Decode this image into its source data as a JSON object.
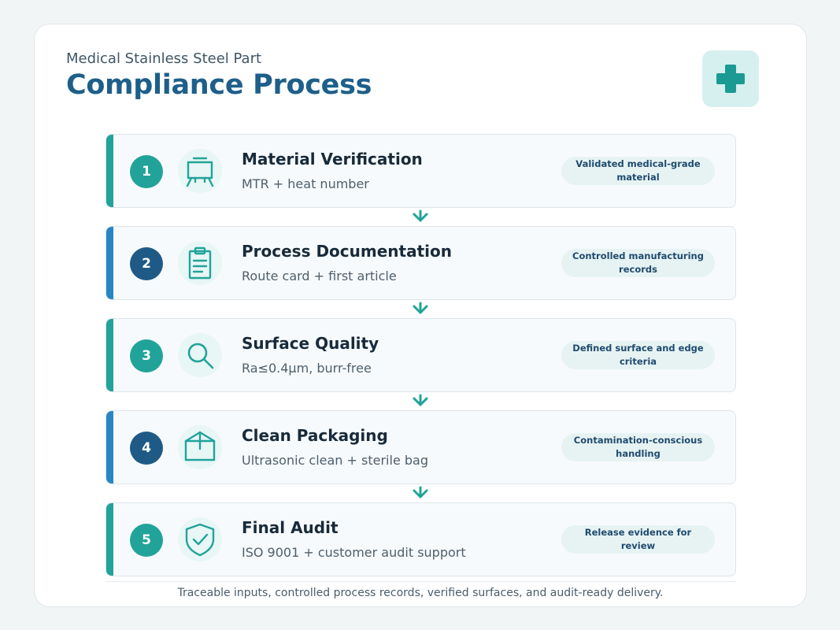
{
  "header": {
    "subtitle": "Medical Stainless Steel Part",
    "title": "Compliance Process",
    "badge_icon": "medical-cross-icon"
  },
  "colors": {
    "teal": "#22a39a",
    "blue": "#1f5a86",
    "accent_teal": "#22a39a",
    "accent_blue": "#2a86c2"
  },
  "steps": [
    {
      "number": "1",
      "title": "Material Verification",
      "description": "MTR + heat number",
      "outcome": "Validated medical-grade material",
      "icon": "easel-board-icon"
    },
    {
      "number": "2",
      "title": "Process Documentation",
      "description": "Route card + first article",
      "outcome": "Controlled manufacturing records",
      "icon": "clipboard-icon"
    },
    {
      "number": "3",
      "title": "Surface Quality",
      "description": "Ra≤0.4μm, burr-free",
      "outcome": "Defined surface and edge criteria",
      "icon": "magnifier-icon"
    },
    {
      "number": "4",
      "title": "Clean Packaging",
      "description": "Ultrasonic clean + sterile bag",
      "outcome": "Contamination-conscious handling",
      "icon": "box-icon"
    },
    {
      "number": "5",
      "title": "Final Audit",
      "description": "ISO 9001 + customer audit support",
      "outcome": "Release evidence for review",
      "icon": "shield-check-icon"
    }
  ],
  "footer": "Traceable inputs, controlled process records, verified surfaces, and audit-ready delivery."
}
